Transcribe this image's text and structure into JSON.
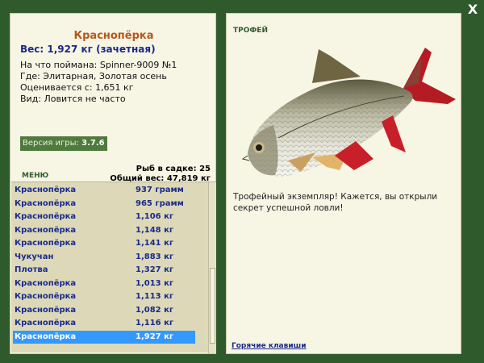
{
  "fish": {
    "name": "Краснопёрка",
    "weight": "Вес: 1,927 кг (зачетная)",
    "caught_with": "На что поймана: Spinner-9009 №1",
    "location": "Где: Элитарная, Золотая осень",
    "valued_from": "Оценивается с: 1,651 кг",
    "kind": "Вид: Ловится не часто"
  },
  "version": {
    "label": "Версия игры:",
    "value": "3.7.6"
  },
  "menu_label": "МЕНЮ",
  "stats": {
    "fish_in_cage": "Рыб в садке: 25",
    "total_weight": "Общий вес: 47,819 кг"
  },
  "catch_list": [
    {
      "name": "Краснопёрка",
      "weight": "937 грамм"
    },
    {
      "name": "Краснопёрка",
      "weight": "965 грамм"
    },
    {
      "name": "Краснопёрка",
      "weight": "1,106 кг"
    },
    {
      "name": "Краснопёрка",
      "weight": "1,148 кг"
    },
    {
      "name": "Краснопёрка",
      "weight": "1,141 кг"
    },
    {
      "name": "Чукучан",
      "weight": "1,883 кг"
    },
    {
      "name": "Плотва",
      "weight": "1,327 кг"
    },
    {
      "name": "Краснопёрка",
      "weight": "1,013 кг"
    },
    {
      "name": "Краснопёрка",
      "weight": "1,113 кг"
    },
    {
      "name": "Краснопёрка",
      "weight": "1,082 кг"
    },
    {
      "name": "Краснопёрка",
      "weight": "1,116 кг"
    },
    {
      "name": "Краснопёрка",
      "weight": "1,927 кг"
    }
  ],
  "selected_index": 11,
  "trophy": {
    "label": "ТРОФЕЙ",
    "text": "Трофейный экземпляр! Кажется, вы открыли секрет успешной ловли!"
  },
  "hotkeys_label": "Горячие клавиши",
  "close_label": "X",
  "colors": {
    "background": "#2f5a2b",
    "panel": "#f7f5e4",
    "title": "#b8561a",
    "list_text": "#1a2a8a",
    "selection": "#3399ff"
  }
}
